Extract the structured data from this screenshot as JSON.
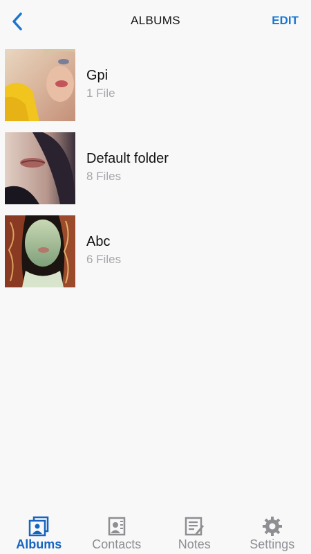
{
  "header": {
    "back_icon": "chevron-left-icon",
    "title": "ALBUMS",
    "edit_label": "EDIT",
    "accent_color": "#1976d2"
  },
  "albums": [
    {
      "name": "Gpi",
      "count": "1 File"
    },
    {
      "name": "Default folder",
      "count": "8 Files"
    },
    {
      "name": "Abc",
      "count": "6 Files"
    }
  ],
  "tabs": [
    {
      "label": "Albums",
      "icon": "albums-icon",
      "active": true
    },
    {
      "label": "Contacts",
      "icon": "contacts-icon",
      "active": false
    },
    {
      "label": "Notes",
      "icon": "notes-icon",
      "active": false
    },
    {
      "label": "Settings",
      "icon": "gear-icon",
      "active": false
    }
  ]
}
